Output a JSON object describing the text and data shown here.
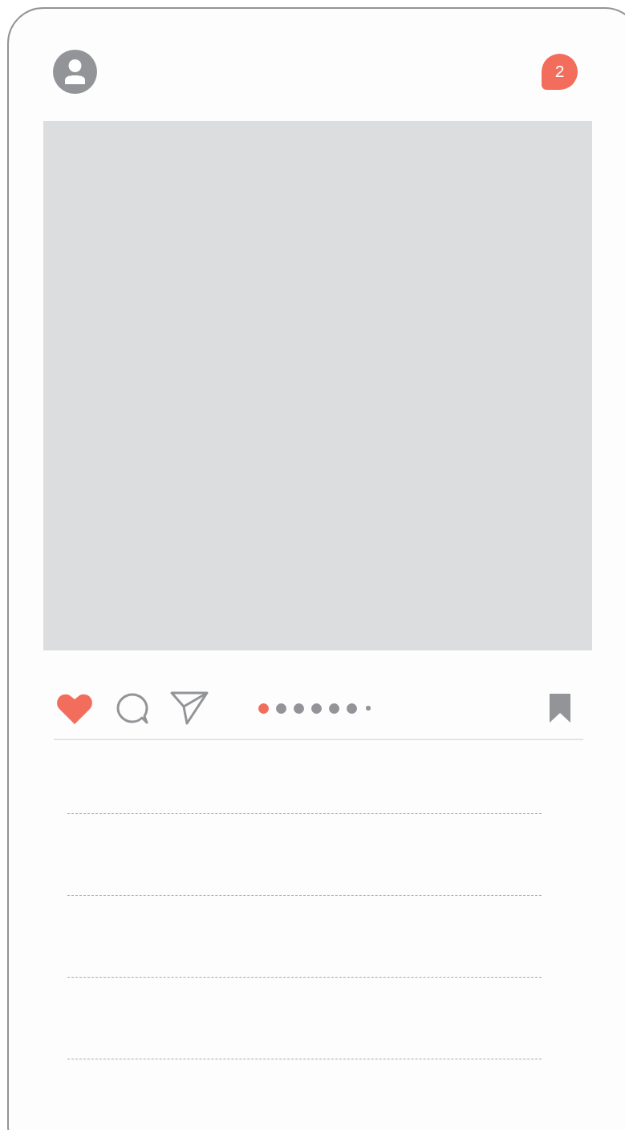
{
  "header": {
    "notification_count": "2"
  },
  "post": {
    "image": {
      "kind": "placeholder"
    }
  },
  "actions": {
    "liked": true,
    "saved": true
  },
  "carousel": {
    "dots": [
      {
        "selected": true,
        "kind": "dot"
      },
      {
        "selected": false,
        "kind": "dot"
      },
      {
        "selected": false,
        "kind": "dot"
      },
      {
        "selected": false,
        "kind": "dot"
      },
      {
        "selected": false,
        "kind": "dot"
      },
      {
        "selected": false,
        "kind": "dot"
      },
      {
        "selected": false,
        "kind": "small"
      }
    ]
  }
}
